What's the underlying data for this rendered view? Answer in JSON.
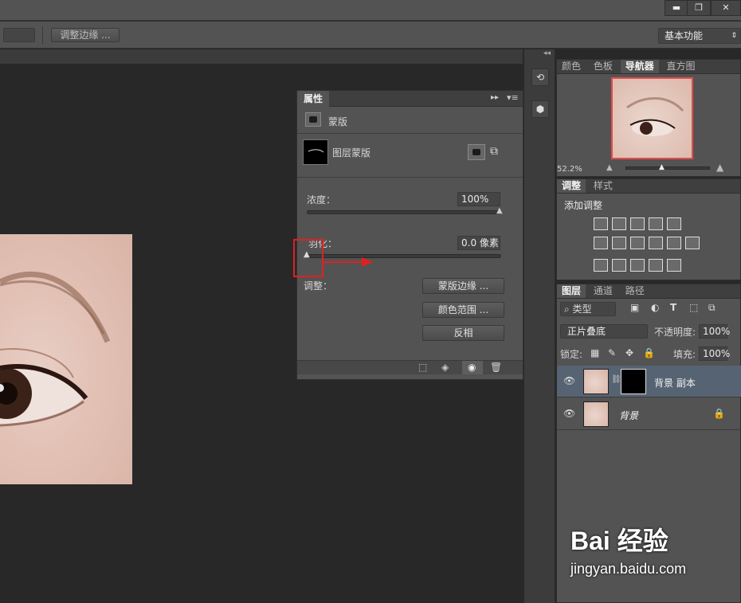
{
  "window_controls": {
    "minimize": "▬",
    "restore": "❐",
    "close": "✕"
  },
  "options_bar": {
    "refine_edge_label": "调整边缘 ...",
    "workspace": "基本功能"
  },
  "properties_panel": {
    "tab": "属性",
    "mask_section_label": "蒙版",
    "layer_mask_label": "图层蒙版",
    "density_label": "浓度：",
    "density_value": "100%",
    "feather_label": "羽化：",
    "feather_value": "0.0 像素",
    "adjust_label": "调整：",
    "mask_edge_button": "蒙版边缘 ...",
    "color_range_button": "颜色范围 ...",
    "invert_button": "反相"
  },
  "navigator_panel": {
    "tabs": [
      "颜色",
      "色板",
      "导航器",
      "直方图"
    ],
    "active_tab": "导航器",
    "zoom": "52.2%"
  },
  "adjustments_panel": {
    "tabs": [
      "调整",
      "样式"
    ],
    "title": "添加调整"
  },
  "layers_panel": {
    "tabs": [
      "图层",
      "通道",
      "路径"
    ],
    "filter_kind": "类型",
    "blend_mode": "正片叠底",
    "opacity_label": "不透明度:",
    "opacity_value": "100%",
    "lock_label": "锁定:",
    "fill_label": "填充:",
    "fill_value": "100%",
    "layers": [
      {
        "name": "背景 副本",
        "selected": true
      },
      {
        "name": "背景",
        "selected": false
      }
    ]
  },
  "colors": {
    "highlight_box": "#e02020",
    "selected_layer": "#566373",
    "panel_bg": "#535353"
  },
  "watermark": {
    "brand": "Bai 经验",
    "url": "jingyan.baidu.com"
  }
}
